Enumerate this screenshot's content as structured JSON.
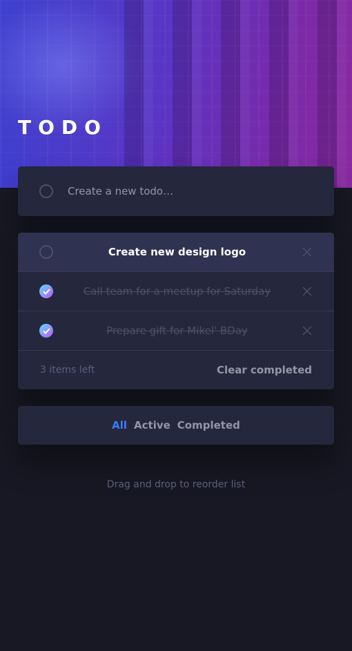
{
  "header": {
    "title": "TODO"
  },
  "new_todo": {
    "placeholder": "Create a new todo…"
  },
  "todos": [
    {
      "text": "Create new design logo",
      "completed": false
    },
    {
      "text": "Call team for a meetup for Saturday",
      "completed": true
    },
    {
      "text": "Prepare gift for Mikel' BDay",
      "completed": true
    }
  ],
  "footer": {
    "items_left": "3 items left",
    "clear_label": "Clear completed"
  },
  "filters": {
    "all": "All",
    "active": "Active",
    "completed": "Completed",
    "selected": "all"
  },
  "hint": "Drag and drop to reorder list",
  "colors": {
    "background": "#171823",
    "card": "#25273d",
    "accent": "#3a7cfd",
    "check_gradient_start": "#55ddff",
    "check_gradient_end": "#c058f3"
  },
  "icons": {
    "checkbox": "circle-checkbox-icon",
    "check": "check-icon",
    "delete": "cross-icon"
  }
}
